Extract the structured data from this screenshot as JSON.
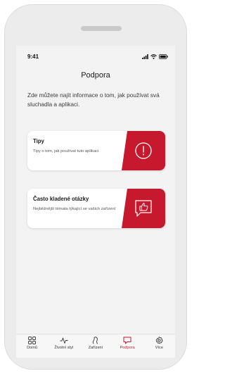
{
  "status_bar": {
    "time": "9:41"
  },
  "header": {
    "title": "Podpora"
  },
  "intro": "Zde můžete najít informace o tom, jak používat svá sluchadla a aplikaci.",
  "cards": [
    {
      "title": "Tipy",
      "description": "Tipy o tom, jak používat tuto aplikaci",
      "icon": "exclamation-circle-icon"
    },
    {
      "title": "Často kladené otázky",
      "description": "Nejběžnější témata týkající se vašich zařízení",
      "icon": "thumbs-up-speech-icon"
    }
  ],
  "tabbar": {
    "items": [
      {
        "label": "Domů",
        "icon": "grid-icon"
      },
      {
        "label": "Životní styl",
        "icon": "activity-icon"
      },
      {
        "label": "Zařízení",
        "icon": "hearing-aid-icon"
      },
      {
        "label": "Podpora",
        "icon": "chat-icon",
        "active": true
      },
      {
        "label": "Více",
        "icon": "gear-icon"
      }
    ]
  },
  "colors": {
    "accent": "#c6192e",
    "background": "#f3f3f3"
  }
}
